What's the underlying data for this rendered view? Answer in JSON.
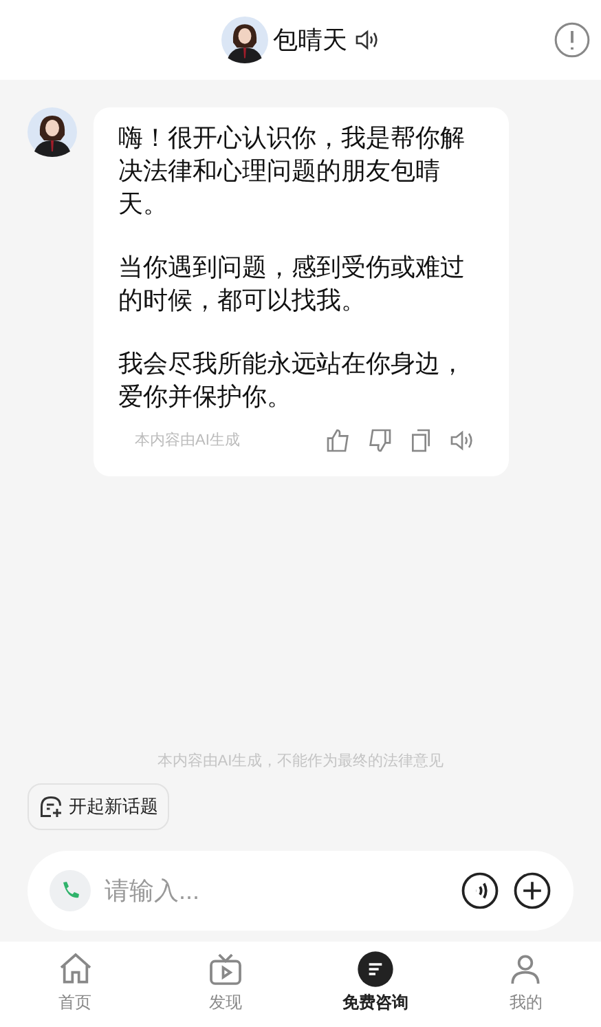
{
  "header": {
    "title": "包晴天"
  },
  "messages": [
    {
      "paragraphs": [
        "嗨！很开心认识你，我是帮你解决法律和心理问题的朋友包晴天。",
        "当你遇到问题，感到受伤或难过的时候，都可以找我。",
        "我会尽我所能永远站在你身边，爱你并保护你。"
      ],
      "note": "本内容由AI生成"
    }
  ],
  "disclaimer": "本内容由AI生成，不能作为最终的法律意见",
  "new_topic": "开起新话题",
  "input": {
    "placeholder": "请输入..."
  },
  "tabs": [
    {
      "label": "首页",
      "selected": false,
      "kind": "home"
    },
    {
      "label": "发现",
      "selected": false,
      "kind": "tv"
    },
    {
      "label": "免费咨询",
      "selected": true,
      "kind": "consult"
    },
    {
      "label": "我的",
      "selected": false,
      "kind": "user"
    }
  ]
}
